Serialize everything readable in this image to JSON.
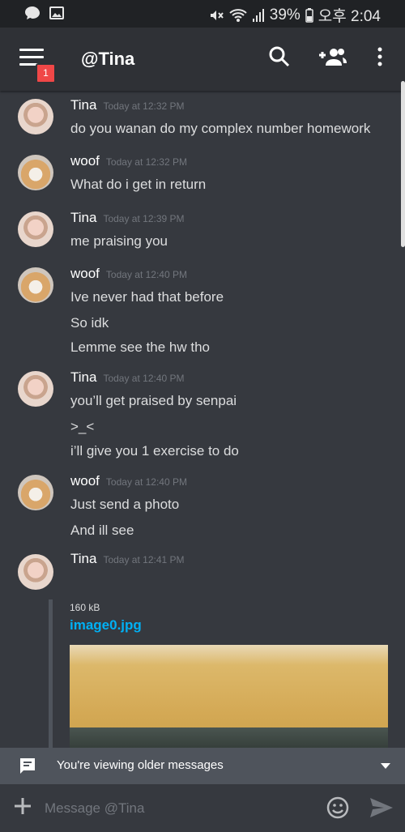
{
  "status_bar": {
    "battery": "39%",
    "time": "오후 2:04"
  },
  "header": {
    "title": "@Tina",
    "badge_count": "1"
  },
  "messages": [
    {
      "user": "Tina",
      "time": "Today at 12:32 PM",
      "lines": [
        "do you wanan do my complex number homework"
      ]
    },
    {
      "user": "woof",
      "time": "Today at 12:32 PM",
      "lines": [
        "What do i get in return"
      ]
    },
    {
      "user": "Tina",
      "time": "Today at 12:39 PM",
      "lines": [
        "me praising you"
      ]
    },
    {
      "user": "woof",
      "time": "Today at 12:40 PM",
      "lines": [
        "Ive never had that before",
        "So idk",
        "Lemme see the hw tho"
      ]
    },
    {
      "user": "Tina",
      "time": "Today at 12:40 PM",
      "lines": [
        "you’ll get praised by senpai",
        ">_<",
        "i’ll give you 1 exercise to do"
      ]
    },
    {
      "user": "woof",
      "time": "Today at 12:40 PM",
      "lines": [
        "Just send a photo",
        "And ill see"
      ]
    },
    {
      "user": "Tina",
      "time": "Today at 12:41 PM",
      "lines": []
    }
  ],
  "attachment": {
    "size": "160 kB",
    "filename": "image0.jpg"
  },
  "older_bar": {
    "text": "You're viewing older messages"
  },
  "composer": {
    "placeholder": "Message @Tina"
  },
  "icons": [
    "chat-bubble-icon",
    "gallery-icon",
    "mute-icon",
    "wifi-icon",
    "signal-icon",
    "battery-icon",
    "menu-icon",
    "search-icon",
    "add-friend-icon",
    "more-vertical-icon",
    "message-icon",
    "chevron-down-icon",
    "plus-icon",
    "emoji-icon",
    "send-icon"
  ],
  "colors": {
    "background": "#36393f",
    "appbar": "#2f3136",
    "link": "#00b0f4",
    "badge": "#f04747"
  }
}
